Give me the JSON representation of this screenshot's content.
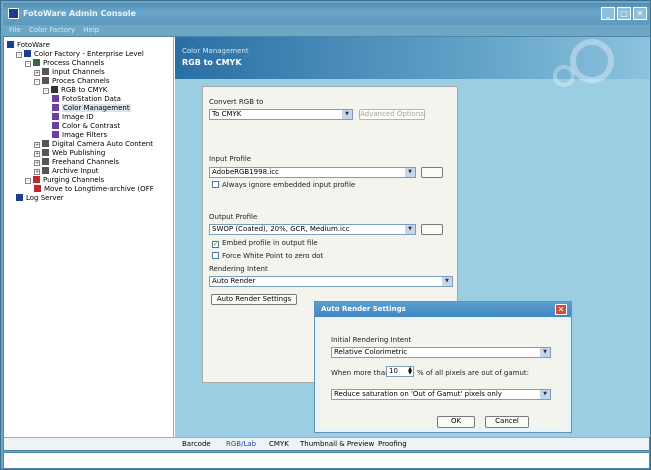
{
  "window": {
    "title": "FotoWare Admin Console"
  },
  "menu": [
    "File",
    "Color Factory",
    "Help"
  ],
  "tree": [
    {
      "label": "FotoWare",
      "level": 0,
      "icon": "fotoware-icon",
      "color": "#1b3e8a"
    },
    {
      "label": "Color Factory - Enterprise Level",
      "level": 1,
      "icon": "server-icon",
      "color": "#1b3e8a",
      "exp": "-"
    },
    {
      "label": "Process Channels",
      "level": 2,
      "icon": "folder-icon",
      "color": "#3a6a3a",
      "exp": "-"
    },
    {
      "label": "Input Channels",
      "level": 3,
      "icon": "channel-icon",
      "color": "#555555",
      "exp": "+"
    },
    {
      "label": "Proces Channels",
      "level": 3,
      "icon": "channel-icon",
      "color": "#555555",
      "exp": "-"
    },
    {
      "label": "RGB to CMYK",
      "level": 4,
      "icon": "grid-icon",
      "color": "#333333",
      "exp": "-"
    },
    {
      "label": "FotoStation Data",
      "level": 5,
      "icon": "data-icon",
      "color": "#6b3fa0"
    },
    {
      "label": "Color Management",
      "level": 5,
      "icon": "color-icon",
      "color": "#6b3fa0",
      "selected": true
    },
    {
      "label": "Image ID",
      "level": 5,
      "icon": "id-icon",
      "color": "#6b3fa0"
    },
    {
      "label": "Color & Contrast",
      "level": 5,
      "icon": "contrast-icon",
      "color": "#6b3fa0"
    },
    {
      "label": "Image Filters",
      "level": 5,
      "icon": "filter-icon",
      "color": "#6b3fa0"
    },
    {
      "label": "Digital Camera Auto Content",
      "level": 3,
      "icon": "channel-icon",
      "color": "#555555",
      "exp": "+"
    },
    {
      "label": "Web Publishing",
      "level": 3,
      "icon": "channel-icon",
      "color": "#555555",
      "exp": "+"
    },
    {
      "label": "Freehand Channels",
      "level": 3,
      "icon": "channel-icon",
      "color": "#555555",
      "exp": "+"
    },
    {
      "label": "Archive Input",
      "level": 3,
      "icon": "channel-icon",
      "color": "#555555",
      "exp": "+"
    },
    {
      "label": "Purging Channels",
      "level": 2,
      "icon": "purge-icon",
      "color": "#c2282a",
      "exp": "-"
    },
    {
      "label": "Move to Longtime-archive (OFF",
      "level": 3,
      "icon": "move-icon",
      "color": "#c2282a"
    },
    {
      "label": "Log Server",
      "level": 1,
      "icon": "log-icon",
      "color": "#1b3e8a"
    }
  ],
  "banner": {
    "subtitle": "Color Management",
    "title": "RGB to CMYK"
  },
  "panel": {
    "convert_label": "Convert RGB to",
    "convert_value": "To CMYK",
    "advanced_button": "Advanced Options",
    "input_profile_label": "Input Profile",
    "input_profile_value": "AdobeRGB1998.icc",
    "ignore_embedded": "Always ignore embedded input profile",
    "output_profile_label": "Output Profile",
    "output_profile_value": "SWOP (Coated), 20%, GCR, Medium.icc",
    "embed_profile": "Embed profile in output file",
    "force_white": "Force White Point to zero dot",
    "rendering_intent_label": "Rendering Intent",
    "rendering_intent_value": "Auto Render",
    "auto_render_button": "Auto Render Settings"
  },
  "dialog": {
    "title": "Auto Render Settings",
    "initial_label": "Initial Rendering Intent",
    "initial_value": "Relative Colorimetric",
    "when_label": "When more than",
    "percent_value": "10",
    "percent_suffix": "% of all pixels are out of gamut:",
    "action_value": "Reduce saturation on 'Out of Gamut' pixels only",
    "ok_button": "OK",
    "cancel_button": "Cancel"
  },
  "tabs": [
    "Barcode",
    "RGB/Lab",
    "CMYK",
    "Thumbnail & Preview",
    "Proofing"
  ],
  "active_tab": 1,
  "colors": {
    "accent": "#6ea7c6",
    "panel_bg": "#9bcde3",
    "selected": "#1c4ea8"
  }
}
